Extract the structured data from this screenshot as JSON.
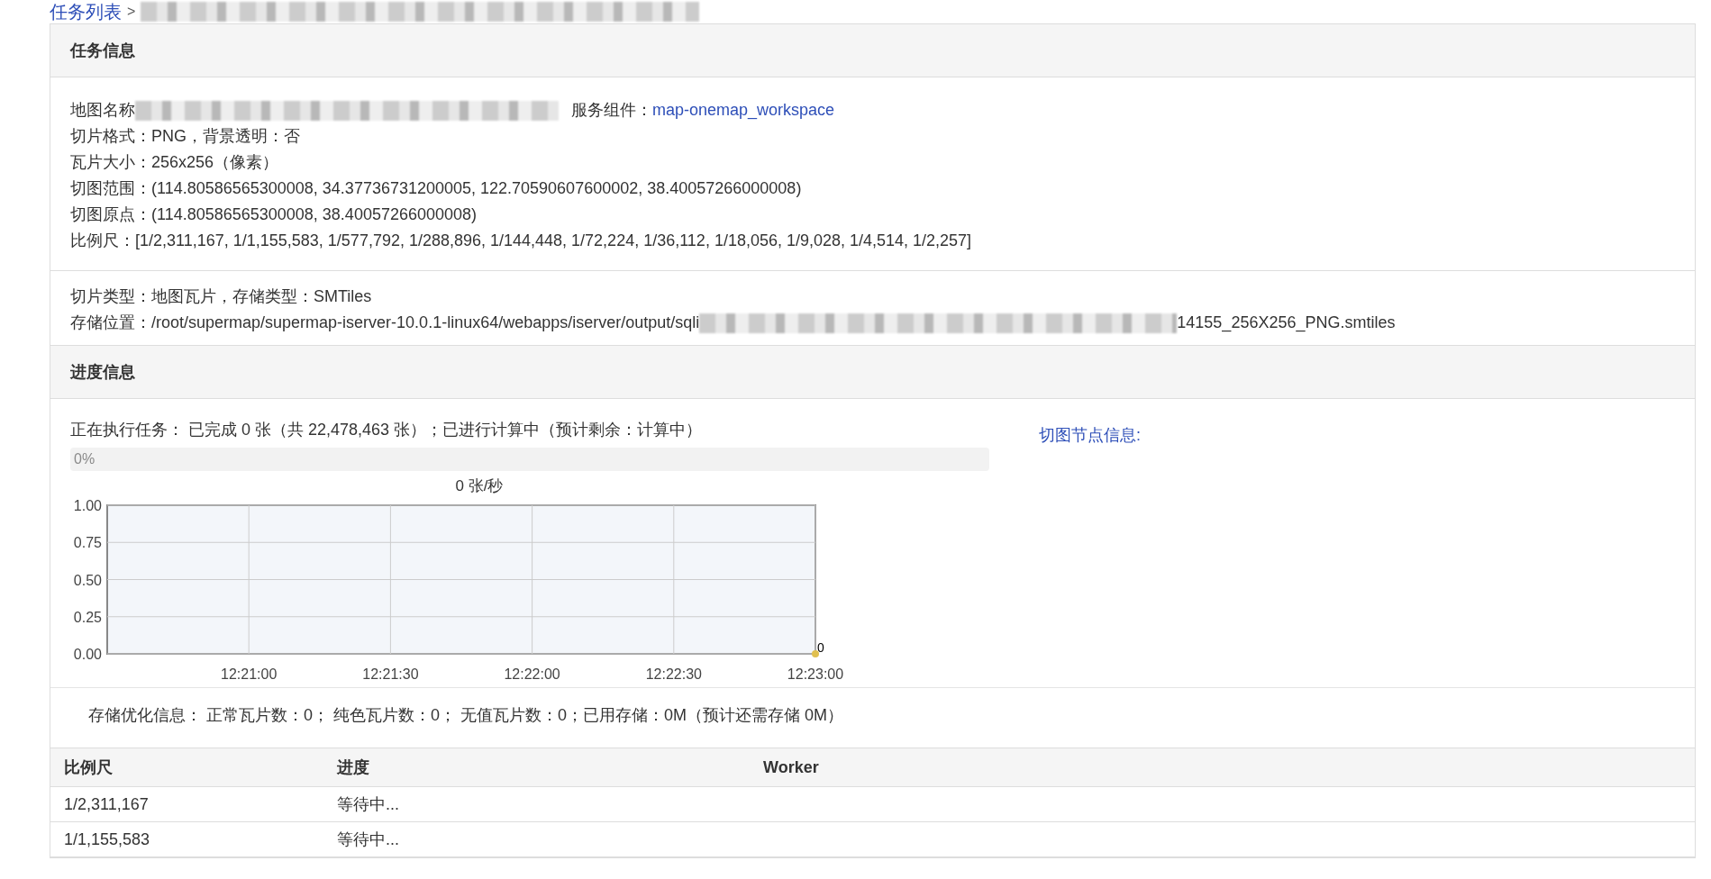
{
  "breadcrumb": {
    "link": "任务列表",
    "separator": ">"
  },
  "task_info": {
    "title": "任务信息",
    "map_name_label": "地图名称",
    "service_label": "服务组件：",
    "service_link": "map-onemap_workspace",
    "lines": [
      "切片格式：PNG，背景透明：否",
      "瓦片大小：256x256（像素）",
      "切图范围：(114.80586565300008, 34.37736731200005, 122.70590607600002, 38.40057266000008)",
      "切图原点：(114.80586565300008, 38.40057266000008)",
      "比例尺：[1/2,311,167, 1/1,155,583, 1/577,792, 1/288,896, 1/144,448, 1/72,224, 1/36,112, 1/18,056, 1/9,028, 1/4,514, 1/2,257]"
    ],
    "storage_lines": [
      {
        "text": "切片类型：地图瓦片，存储类型：SMTiles"
      },
      {
        "text": "存储位置：/root/supermap/supermap-iserver-10.0.1-linux64/webapps/iserver/output/sqli",
        "suffix": "14155_256X256_PNG.smtiles"
      }
    ]
  },
  "progress_info": {
    "title": "进度信息",
    "status": "正在执行任务： 已完成 0 张（共 22,478,463 张）；已进行计算中（预计剩余：计算中）",
    "node_link": "切图节点信息:",
    "progress": {
      "level": 0,
      "label": "0%"
    },
    "chart_data": {
      "type": "line",
      "title": "0 张/秒",
      "categories": [
        "12:21:00",
        "12:21:30",
        "12:22:00",
        "12:22:30",
        "12:23:00"
      ],
      "ylim": [
        0,
        1
      ],
      "yticks": [
        {
          "value": 0,
          "label": "0.00"
        },
        {
          "value": 0.25,
          "label": "0.25"
        },
        {
          "value": 0.5,
          "label": "0.50"
        },
        {
          "value": 0.75,
          "label": "0.75"
        },
        {
          "value": 1,
          "label": "1.00"
        }
      ],
      "data_labels": true,
      "grid": true,
      "series": [
        {
          "color": "#e0c050",
          "marker": true,
          "values": [
            null,
            null,
            null,
            null,
            0
          ]
        }
      ]
    },
    "storage_opt": "存储优化信息： 正常瓦片数：0； 纯色瓦片数：0； 无值瓦片数：0；已用存储：0M（预计还需存储 0M）"
  },
  "table": {
    "columns": [
      "比例尺",
      "进度",
      "Worker"
    ],
    "rows": [
      [
        "1/2,311,167",
        "等待中..."
      ],
      [
        "1/1,155,583",
        "等待中..."
      ]
    ]
  }
}
